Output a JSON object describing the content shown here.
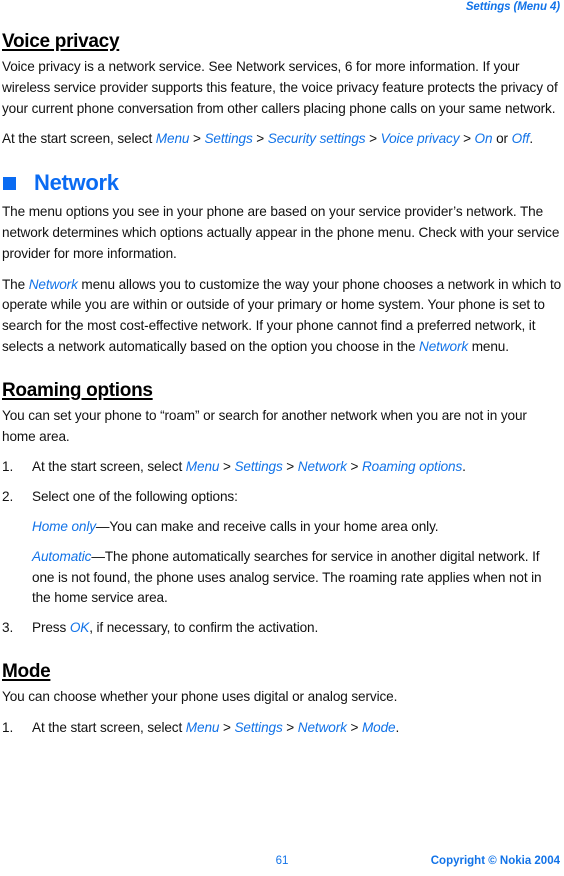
{
  "document": {
    "running_head": "Settings (Menu 4)",
    "accent_blue": "#1273e8",
    "heading_blue": "#0a6bf2",
    "body_black": "#111111"
  },
  "sections": {
    "voice_privacy": {
      "heading": "Voice privacy",
      "paragraph": "Voice privacy is a network service. See Network services, 6 for more information. If your wireless service provider supports this feature, the voice privacy feature protects the privacy of your current phone conversation from other callers placing phone calls on your same network.",
      "path_intro": "At the start screen, select ",
      "path": {
        "item1": "Menu",
        "item2": "Settings",
        "item3": "Security settings",
        "item4": "Voice privacy",
        "item5": "On",
        "conjunction": " or ",
        "item6": "Off",
        "period": "."
      }
    },
    "network": {
      "heading": "Network",
      "bullet_icon": "blue-square-bullet",
      "paragraph1": "The menu options you see in your phone are based on your service provider’s network. The network determines which options actually appear in the phone menu. Check with your service provider for more information.",
      "paragraph2_pre": "The ",
      "paragraph2_ref1": "Network",
      "paragraph2_mid": " menu allows you to customize the way your phone chooses a network in which to operate while you are within or outside of your primary or home system. Your phone is set to search for the most cost-effective network. If your phone cannot find a preferred network, it selects a network automatically based on the option you choose in the ",
      "paragraph2_ref2": "Network",
      "paragraph2_post": " menu."
    },
    "roaming_options": {
      "heading": "Roaming options",
      "paragraph": "You can set your phone to “roam” or search for another network when you are not in your home area.",
      "step1": {
        "number": "1.",
        "text_pre": "At the start screen, select ",
        "path1": "Menu",
        "path2": "Settings",
        "path3": "Network",
        "path4": "Roaming options",
        "text_post": "."
      },
      "step2": {
        "number": "2.",
        "text": "Select one of the following options:"
      },
      "option_home": {
        "term": "Home only",
        "definition": "—You can make and receive calls in your home area only."
      },
      "option_automatic": {
        "term": "Automatic",
        "definition": "—The phone automatically searches for service in another digital network. If one is not found, the phone uses analog service. The roaming rate applies when not in the home service area."
      },
      "step3": {
        "number": "3.",
        "text_pre": "Press ",
        "key": "OK",
        "text_post": ", if necessary, to confirm the activation."
      }
    },
    "mode": {
      "heading": "Mode",
      "paragraph": "You can choose whether your phone uses digital or analog service.",
      "step1": {
        "number": "1.",
        "text_pre": "At the start screen, select ",
        "path1": "Menu",
        "path2": "Settings",
        "path3": "Network",
        "path4": "Mode",
        "text_post": "."
      }
    }
  },
  "separators": {
    "gt": " > "
  },
  "footer": {
    "page_number": "61",
    "copyright": "Copyright © Nokia 2004"
  }
}
